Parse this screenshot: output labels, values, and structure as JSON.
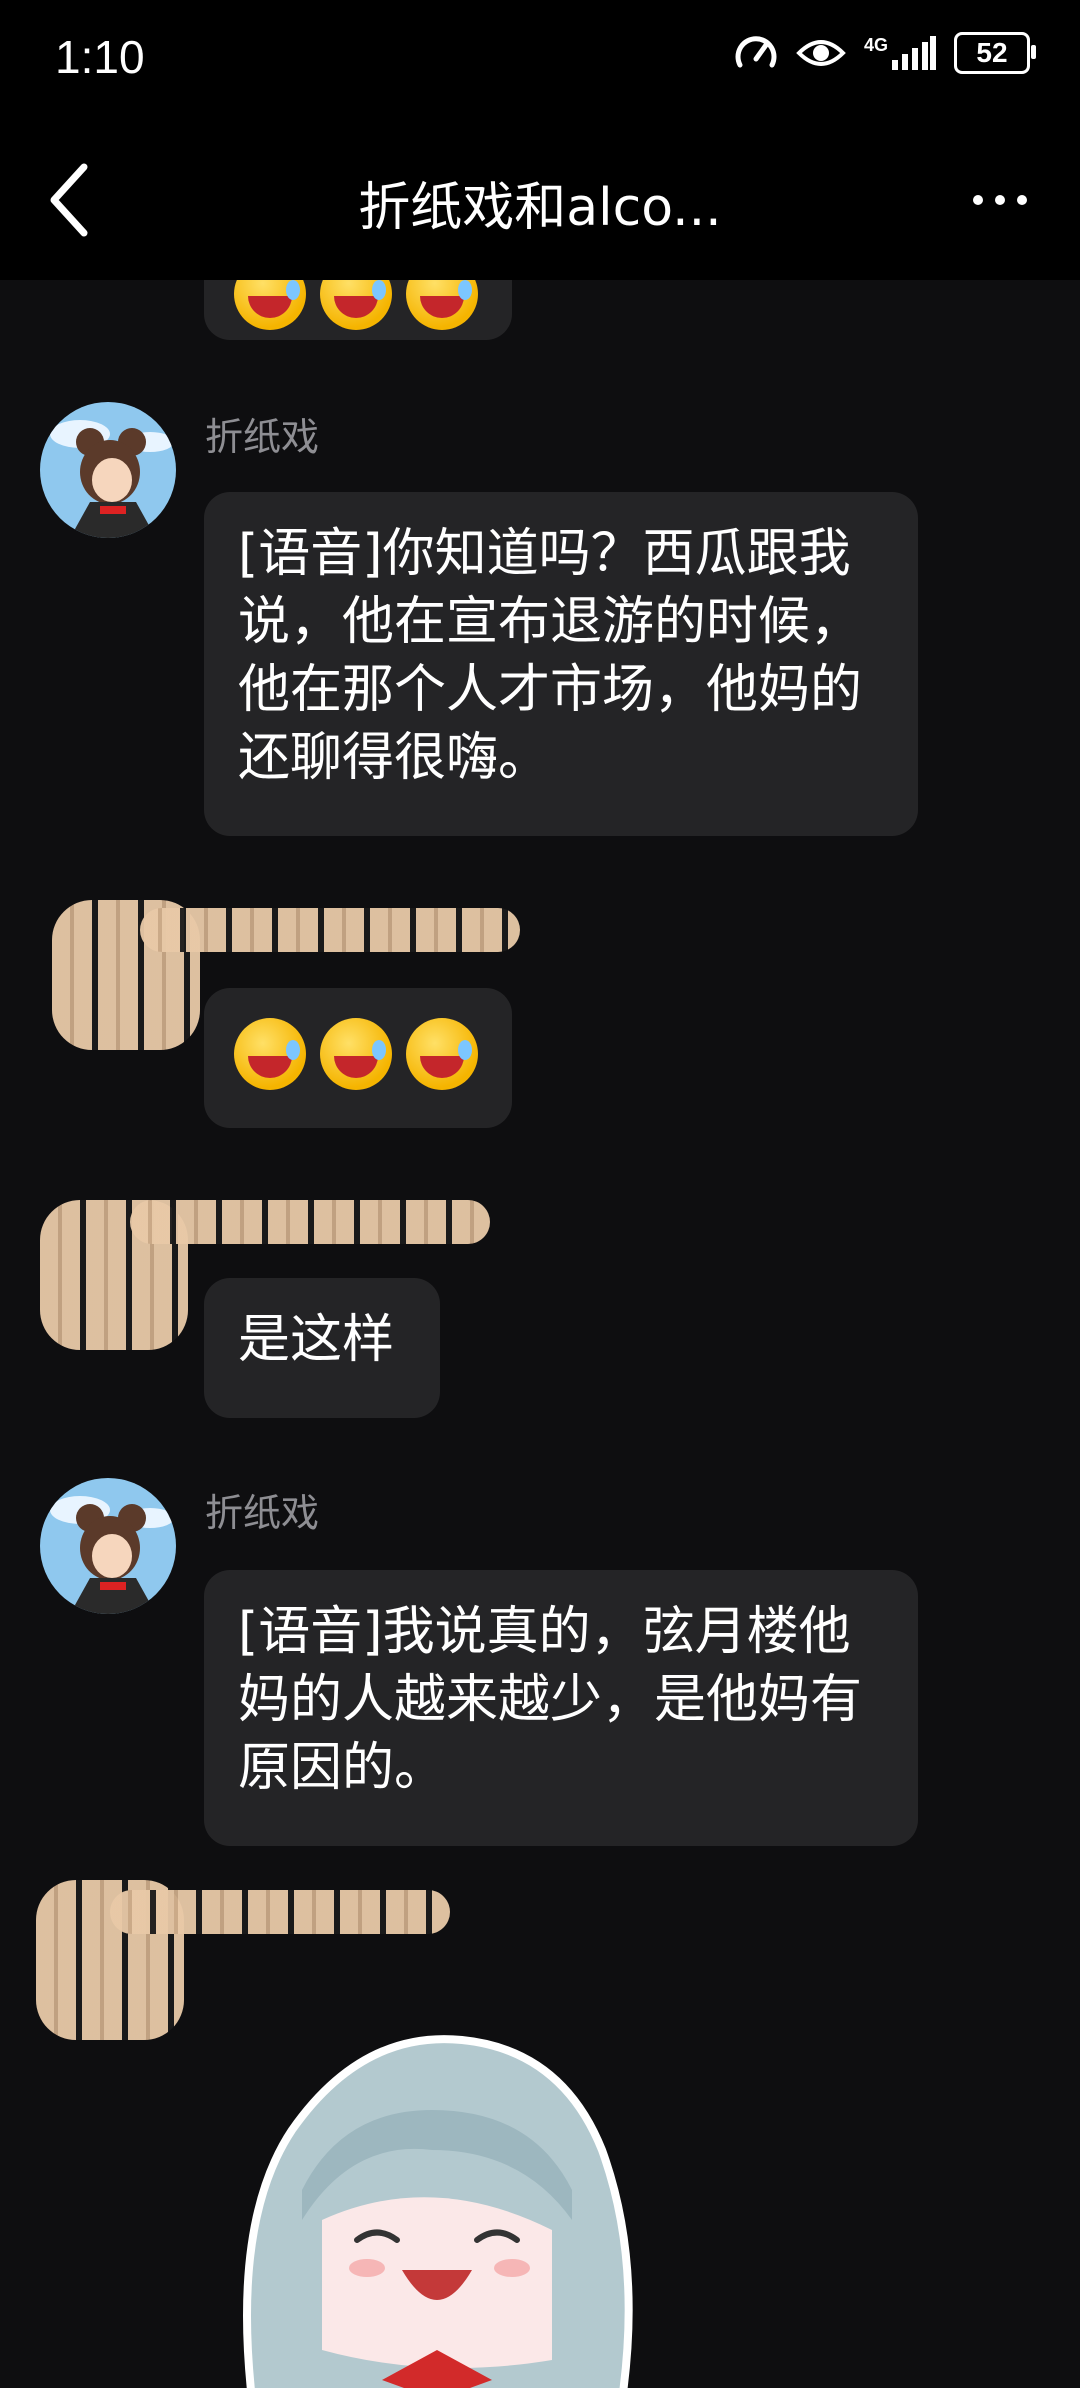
{
  "status_bar": {
    "time": "1:10",
    "battery": "52",
    "network": "4G"
  },
  "header": {
    "title": "折纸戏和alco...",
    "back_icon": "chevron-left-icon",
    "more_icon": "more-horizontal-icon"
  },
  "messages": [
    {
      "sender": "",
      "type": "emoji",
      "content": [
        "laughing-tears-emoji",
        "laughing-tears-emoji",
        "laughing-tears-emoji"
      ]
    },
    {
      "sender": "折纸戏",
      "type": "text",
      "content": "[语音]你知道吗？西瓜跟我说，他在宣布退游的时候，他在那个人才市场，他妈的还聊得很嗨。"
    },
    {
      "sender": "",
      "type": "emoji",
      "content": [
        "laughing-tears-emoji",
        "laughing-tears-emoji",
        "laughing-tears-emoji"
      ]
    },
    {
      "sender": "",
      "type": "text",
      "content": "是这样"
    },
    {
      "sender": "折纸戏",
      "type": "text",
      "content": "[语音]我说真的，弦月楼他妈的人越来越少，是他妈有原因的。"
    },
    {
      "sender": "",
      "type": "sticker",
      "content": "anime-girl-laughing-sticker"
    }
  ],
  "colors": {
    "background": "#0e0e10",
    "bubble": "#242426",
    "sender_name": "#8e8e93"
  }
}
